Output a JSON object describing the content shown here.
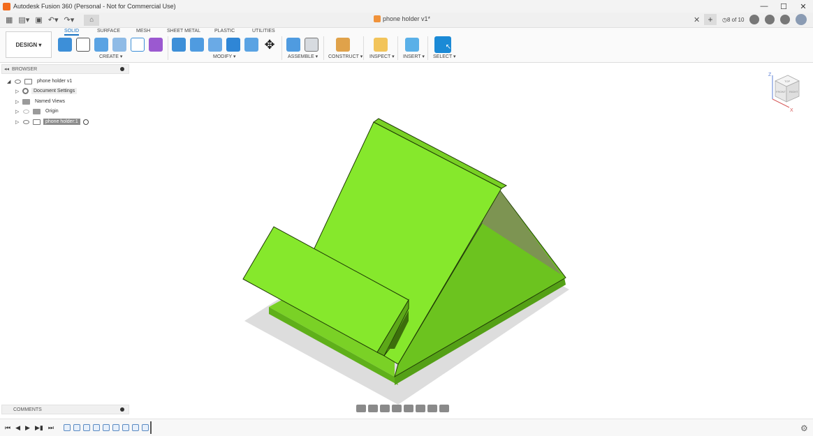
{
  "window": {
    "title": "Autodesk Fusion 360 (Personal - Not for Commercial Use)"
  },
  "document_tab": {
    "name": "phone holder v1*"
  },
  "job_status": {
    "text": "8 of 10"
  },
  "workspace": {
    "label": "DESIGN ▾"
  },
  "ribbon": {
    "tabs": [
      "SOLID",
      "SURFACE",
      "MESH",
      "SHEET METAL",
      "PLASTIC",
      "UTILITIES"
    ],
    "groups": [
      "CREATE ▾",
      "MODIFY ▾",
      "ASSEMBLE ▾",
      "CONSTRUCT ▾",
      "INSPECT ▾",
      "INSERT ▾",
      "SELECT ▾"
    ]
  },
  "browser": {
    "title": "BROWSER",
    "root": "phone holder v1",
    "items": [
      "Document Settings",
      "Named Views",
      "Origin",
      "phone holder:1"
    ]
  },
  "comments": {
    "title": "COMMENTS"
  },
  "viewcube": {
    "axis_z": "Z",
    "axis_x": "X",
    "face_top": "TOP",
    "face_front": "FRONT",
    "face_right": "RIGHT"
  },
  "colors": {
    "model": "#86e82c",
    "accent": "#1a73c2",
    "select_btn": "#1b8ad6"
  }
}
